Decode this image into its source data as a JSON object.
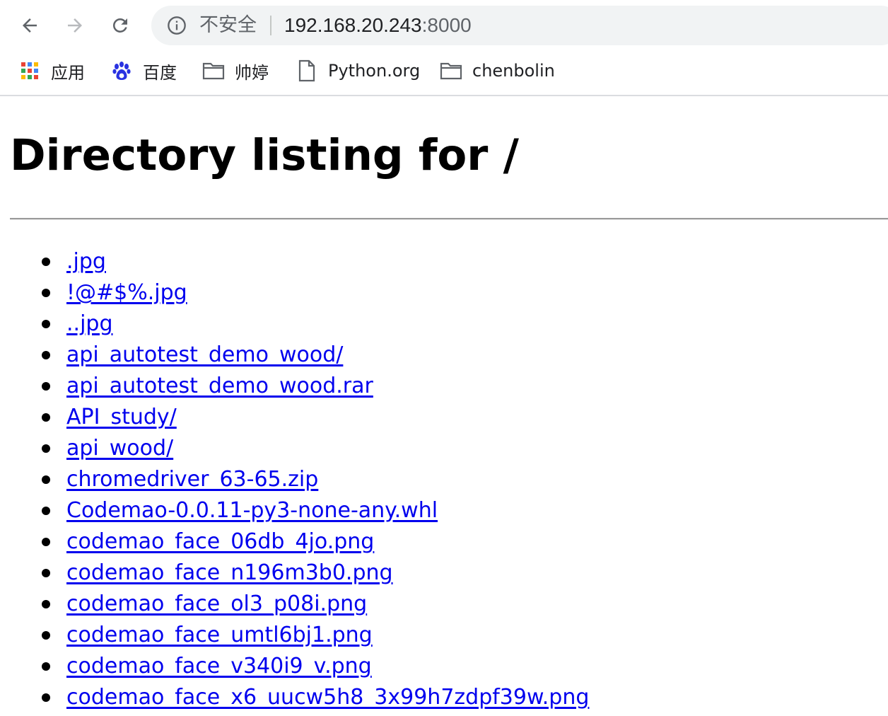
{
  "toolbar": {
    "back_icon": "arrow-left-icon",
    "forward_icon": "arrow-right-icon",
    "reload_icon": "reload-icon",
    "security_icon": "info-circle-icon",
    "security_text": "不安全",
    "url_host": "192.168.20.243",
    "url_port": ":8000"
  },
  "bookmarks": [
    {
      "label": "应用",
      "icon": "apps-grid-icon"
    },
    {
      "label": "百度",
      "icon": "baidu-paw-icon"
    },
    {
      "label": "帅婷",
      "icon": "folder-icon"
    },
    {
      "label": "Python.org",
      "icon": "page-icon"
    },
    {
      "label": "chenbolin",
      "icon": "folder-icon"
    }
  ],
  "page": {
    "title": "Directory listing for /",
    "files": [
      ".jpg",
      "!@#$%.jpg",
      "..jpg",
      "api_autotest_demo_wood/",
      "api_autotest_demo_wood.rar",
      "API_study/",
      "api_wood/",
      "chromedriver_63-65.zip",
      "Codemao-0.0.11-py3-none-any.whl",
      "codemao_face_06db_4jo.png",
      "codemao_face_n196m3b0.png",
      "codemao_face_ol3_p08i.png",
      "codemao_face_umtl6bj1.png",
      "codemao_face_v340i9_v.png",
      "codemao_face_x6_uucw5h8_3x99h7zdpf39w.png"
    ]
  },
  "colors": {
    "link": "#0000ee",
    "omnibox_bg": "#f1f3f4",
    "icon_gray": "#5f6368"
  }
}
